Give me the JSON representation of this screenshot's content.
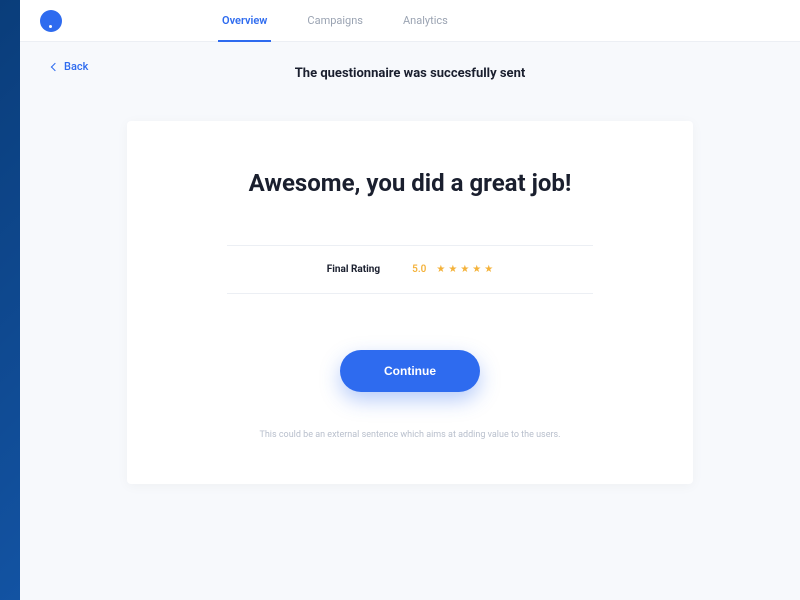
{
  "header": {
    "tabs": [
      {
        "label": "Overview",
        "active": true
      },
      {
        "label": "Campaigns",
        "active": false
      },
      {
        "label": "Analytics",
        "active": false
      }
    ]
  },
  "back": {
    "label": "Back"
  },
  "status": {
    "message": "The questionnaire was succesfully sent"
  },
  "card": {
    "title": "Awesome, you did a great job!",
    "rating_label": "Final Rating",
    "rating_value": "5.0",
    "stars_count": 5,
    "continue_label": "Continue",
    "footer_text": "This could be an external sentence which aims at adding value to the users."
  }
}
